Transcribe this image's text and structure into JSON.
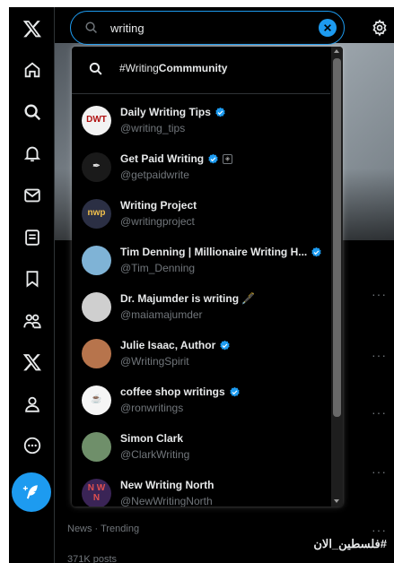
{
  "search": {
    "value": "writing"
  },
  "dropdown": {
    "topic": {
      "prefix": "#Writing",
      "suffix": "Commmunity"
    },
    "users": [
      {
        "name": "Daily Writing Tips",
        "handle": "@writing_tips",
        "verified": true,
        "affiliate": false,
        "avatar_text": "DWT",
        "avatar_bg": "#f2f2f2",
        "avatar_fg": "#b01010"
      },
      {
        "name": "Get Paid Writing",
        "handle": "@getpaidwrite",
        "verified": true,
        "affiliate": true,
        "avatar_text": "✒",
        "avatar_bg": "#1a1a1a",
        "avatar_fg": "#ddd"
      },
      {
        "name": "Writing Project",
        "handle": "@writingproject",
        "verified": false,
        "affiliate": false,
        "avatar_text": "nwp",
        "avatar_bg": "#2b2f44",
        "avatar_fg": "#f3c14b"
      },
      {
        "name": "Tim Denning | Millionaire Writing H...",
        "handle": "@Tim_Denning",
        "verified": true,
        "affiliate": false,
        "avatar_text": "",
        "avatar_bg": "#7fb3d6",
        "avatar_fg": "#fff"
      },
      {
        "name": "Dr. Majumder is writing 🖋️",
        "handle": "@maiamajumder",
        "verified": false,
        "affiliate": false,
        "avatar_text": "",
        "avatar_bg": "#cfcfcf",
        "avatar_fg": "#333"
      },
      {
        "name": "Julie Isaac, Author",
        "handle": "@WritingSpirit",
        "verified": true,
        "affiliate": false,
        "avatar_text": "",
        "avatar_bg": "#b7744c",
        "avatar_fg": "#fff"
      },
      {
        "name": "coffee shop writings",
        "handle": "@ronwritings",
        "verified": true,
        "affiliate": false,
        "avatar_text": "☕",
        "avatar_bg": "#f5f5f5",
        "avatar_fg": "#333"
      },
      {
        "name": "Simon Clark",
        "handle": "@ClarkWriting",
        "verified": false,
        "affiliate": false,
        "avatar_text": "",
        "avatar_bg": "#6f8f6a",
        "avatar_fg": "#fff"
      },
      {
        "name": "New Writing North",
        "handle": "@NewWritingNorth",
        "verified": false,
        "affiliate": false,
        "avatar_text": "N W\nN",
        "avatar_bg": "#3a2456",
        "avatar_fg": "#e05050"
      }
    ]
  },
  "trend": {
    "meta": "News · Trending",
    "name": "#فلسطين_الان",
    "posts": "371K posts"
  },
  "colors": {
    "accent": "#1d9bf0",
    "verified": "#1d9bf0",
    "muted": "#71767b"
  },
  "nav_icons": [
    "x-logo-icon",
    "home-icon",
    "explore-icon",
    "notifications-icon",
    "messages-icon",
    "lists-icon",
    "bookmarks-icon",
    "communities-icon",
    "premium-icon",
    "profile-icon",
    "more-icon",
    "compose-icon"
  ]
}
